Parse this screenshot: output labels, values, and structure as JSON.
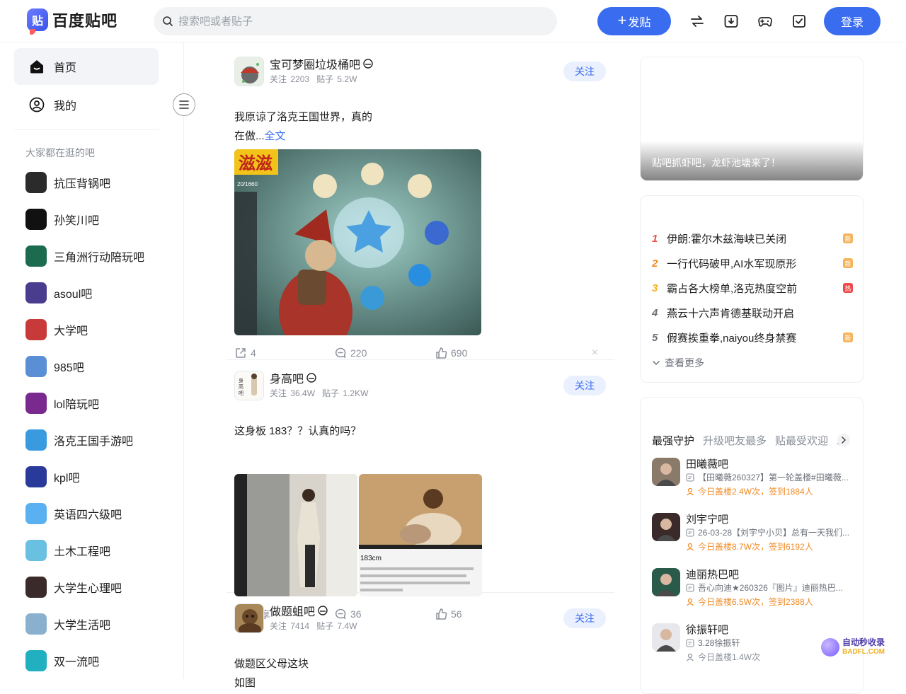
{
  "header": {
    "logo_glyph": "贴",
    "logo_text": "百度贴吧",
    "search_placeholder": "搜索吧或者贴子",
    "post_button": "发贴",
    "post_button_icon": "+",
    "login_button": "登录"
  },
  "sidebar": {
    "nav": [
      {
        "label": "首页",
        "icon": "home-icon",
        "active": true
      },
      {
        "label": "我的",
        "icon": "user-icon",
        "active": false
      }
    ],
    "section_title": "大家都在逛的吧",
    "forums": [
      {
        "name": "抗压背锅吧",
        "color": "#2b2b2b"
      },
      {
        "name": "孙笑川吧",
        "color": "#111111"
      },
      {
        "name": "三角洲行动陪玩吧",
        "color": "#1c6b4f"
      },
      {
        "name": "asoul吧",
        "color": "#4a3d8f"
      },
      {
        "name": "大学吧",
        "color": "#c83a3a"
      },
      {
        "name": "985吧",
        "color": "#5a8fd6"
      },
      {
        "name": "lol陪玩吧",
        "color": "#7a2a8f"
      },
      {
        "name": "洛克王国手游吧",
        "color": "#3a9ae0"
      },
      {
        "name": "kpl吧",
        "color": "#2a3a9a"
      },
      {
        "name": "英语四六级吧",
        "color": "#5ab0f0"
      },
      {
        "name": "土木工程吧",
        "color": "#6ac0e0"
      },
      {
        "name": "大学生心理吧",
        "color": "#3a2a2a"
      },
      {
        "name": "大学生活吧",
        "color": "#8ab0d0"
      },
      {
        "name": "双一流吧",
        "color": "#20b0c0"
      }
    ]
  },
  "feed": [
    {
      "forum": "宝可梦圈垃圾桶吧",
      "follows_label": "关注",
      "follows": "2203",
      "posts_label": "贴子",
      "posts": "5.2W",
      "follow_button": "关注",
      "text_line1": "我原谅了洛克王国世界，真的",
      "text_line2": "在做...",
      "more": "全文",
      "img_overlay_text": "滋滋",
      "img_counter": "20/1660",
      "actions": {
        "share": "4",
        "comment": "220",
        "like": "690"
      }
    },
    {
      "forum": "身高吧",
      "follows_label": "关注",
      "follows": "36.4W",
      "posts_label": "贴子",
      "posts": "1.2KW",
      "follow_button": "关注",
      "text_line1": "这身板 183？？认真的吗？",
      "img_caption": "183cm",
      "actions": {
        "share": "分享",
        "comment": "36",
        "like": "56"
      }
    },
    {
      "forum": "做题蛆吧",
      "follows_label": "关注",
      "follows": "7414",
      "posts_label": "贴子",
      "posts": "7.4W",
      "follow_button": "关注",
      "text_line1": "做题区父母这块",
      "text_line2": "如图"
    }
  ],
  "banner": {
    "caption": "贴吧抓虾吧，龙虾池塘来了！"
  },
  "hot": {
    "items": [
      {
        "rank": "1",
        "title": "伊朗:霍尔木兹海峡已关闭",
        "tag": "新",
        "rank_color": "#f04b4b",
        "tag_color": "#f5b35a"
      },
      {
        "rank": "2",
        "title": "一行代码破甲,AI水军现原形",
        "tag": "新",
        "rank_color": "#f08a24",
        "tag_color": "#f5b35a"
      },
      {
        "rank": "3",
        "title": "霸占各大榜单,洛克热度空前",
        "tag": "热",
        "rank_color": "#f5b020",
        "tag_color": "#f04b4b"
      },
      {
        "rank": "4",
        "title": "燕云十六声肯德基联动开启",
        "tag": "",
        "rank_color": "#6b7079",
        "tag_color": ""
      },
      {
        "rank": "5",
        "title": "假赛挨重拳,naiyou终身禁赛",
        "tag": "新",
        "rank_color": "#6b7079",
        "tag_color": "#f5b35a"
      }
    ],
    "more": "查看更多"
  },
  "guard": {
    "tabs": [
      "最强守护",
      "升级吧友最多",
      "贴最受欢迎",
      "发"
    ],
    "items": [
      {
        "name": "田曦薇吧",
        "desc": "【田曦薇260327】第一轮盖楼#田曦薇...",
        "stat": "今日盖楼2.4W次，签到1884人",
        "highlight": true
      },
      {
        "name": "刘宇宁吧",
        "desc": "26-03-28【刘宇宁小贝】总有一天我们...",
        "stat": "今日盖楼8.7W次，签到6192人",
        "highlight": true
      },
      {
        "name": "迪丽热巴吧",
        "desc": "吾心向迪★260326『图片』迪丽热巴...",
        "stat": "今日盖楼6.5W次，签到2388人",
        "highlight": true
      },
      {
        "name": "徐振轩吧",
        "desc": "3.28徐振轩",
        "stat": "今日盖楼1.4W次",
        "highlight": false
      }
    ]
  },
  "watermark": {
    "line1": "自动秒收录",
    "line2": "BADFL.COM"
  }
}
